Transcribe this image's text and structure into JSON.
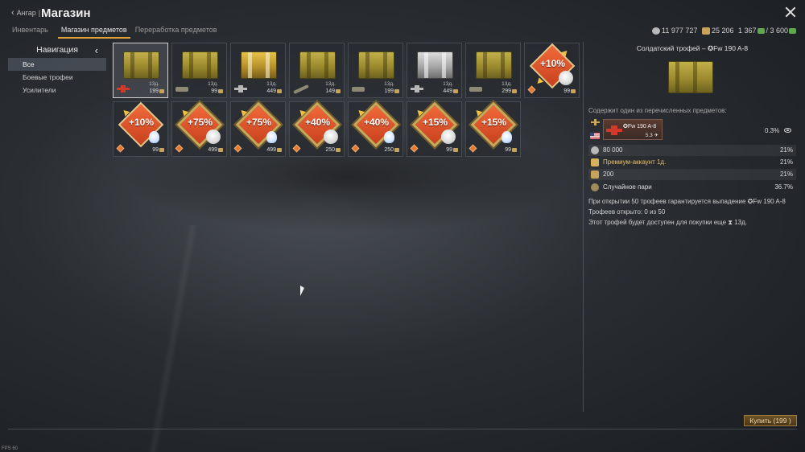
{
  "header": {
    "back_label": "Ангар",
    "title": "Магазин",
    "tabs": [
      {
        "label": "Инвентарь",
        "active": false
      },
      {
        "label": "Магазин предметов",
        "active": true
      },
      {
        "label": "Переработка предметов",
        "active": false
      }
    ],
    "silver": "11 977 727",
    "eagles": "25 206",
    "ge_current": "1 367",
    "ge_max": "/ 3 600"
  },
  "nav": {
    "title": "Навигация",
    "items": [
      {
        "label": "Все",
        "active": true
      },
      {
        "label": "Боевые трофеи",
        "active": false
      },
      {
        "label": "Усилители",
        "active": false
      }
    ]
  },
  "items": [
    {
      "kind": "crate",
      "style": "plain",
      "vehicle": "plane-red",
      "timer": "13д.",
      "price": "199",
      "selected": true
    },
    {
      "kind": "crate",
      "style": "plain",
      "vehicle": "tank",
      "timer": "13д.",
      "price": "99"
    },
    {
      "kind": "crate",
      "style": "striped",
      "vehicle": "plane-grey",
      "timer": "13д.",
      "price": "449"
    },
    {
      "kind": "crate",
      "style": "plain",
      "vehicle": "tank-long",
      "timer": "13д.",
      "price": "149"
    },
    {
      "kind": "crate",
      "style": "plain",
      "vehicle": "tank",
      "timer": "13д.",
      "price": "199"
    },
    {
      "kind": "crate",
      "style": "silver",
      "vehicle": "plane-grey",
      "timer": "13д.",
      "price": "449"
    },
    {
      "kind": "crate",
      "style": "plain",
      "vehicle": "tank",
      "timer": "13д.",
      "price": "299"
    },
    {
      "kind": "booster",
      "text": "+10%",
      "badge": "lion",
      "arrows": "tr",
      "price": "99"
    },
    {
      "kind": "booster",
      "text": "+10%",
      "badge": "bulb",
      "arrows": "tl",
      "price": "99"
    },
    {
      "kind": "booster",
      "text": "+75%",
      "badge": "lion",
      "framed": true,
      "price": "499"
    },
    {
      "kind": "booster",
      "text": "+75%",
      "badge": "bulb",
      "framed": true,
      "price": "499"
    },
    {
      "kind": "booster",
      "text": "+40%",
      "badge": "lion",
      "framed": true,
      "price": "250"
    },
    {
      "kind": "booster",
      "text": "+40%",
      "badge": "bulb",
      "framed": true,
      "price": "250"
    },
    {
      "kind": "booster",
      "text": "+15%",
      "badge": "lion",
      "framed": true,
      "price": "99"
    },
    {
      "kind": "booster",
      "text": "+15%",
      "badge": "bulb",
      "framed": true,
      "price": "99"
    }
  ],
  "panel": {
    "title": "Солдатский трофей – ✪Fw 190 A-8",
    "contains_label": "Содержит один из перечисленных предметов:",
    "vehicle_name": "✪Fw 190 A-8",
    "vehicle_br": "5.3 ✈",
    "vehicle_pct": "0.3%",
    "rewards": [
      {
        "label": "80 000",
        "pct": "21%",
        "icon": "silver-icon"
      },
      {
        "label": "Премиум-аккаунт 1д.",
        "pct": "21%",
        "icon": "premium-icon"
      },
      {
        "label": "200",
        "pct": "21%",
        "icon": "eagle-icon"
      },
      {
        "label": "Случайное пари",
        "pct": "36.7%",
        "icon": "wager-icon"
      }
    ],
    "note_guarantee": "При открытии 50 трофеев гарантируется выпадение ✪Fw 190 A-8",
    "note_opened": "Трофеев открыто: 0 из 50",
    "note_available": "Этот трофей будет доступен для покупки еще ⧗ 13д."
  },
  "buy_label": "Купить (199 )",
  "fps_label": "FPS 60",
  "colors": {
    "accent": "#e0a13a",
    "booster": "#d94f28",
    "crate_gold": "#b8a23e",
    "panel_border": "#6e737d"
  }
}
